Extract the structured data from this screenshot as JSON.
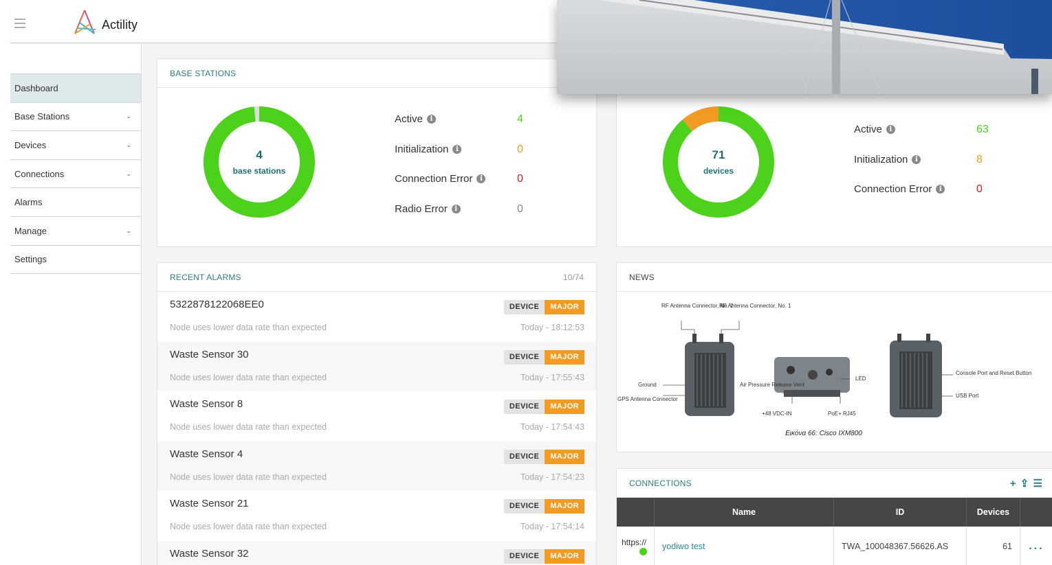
{
  "header": {
    "brand": "Actility"
  },
  "sidebar": {
    "items": [
      {
        "label": "Dashboard",
        "chevron": false,
        "active": true
      },
      {
        "label": "Base Stations",
        "chevron": true
      },
      {
        "label": "Devices",
        "chevron": true
      },
      {
        "label": "Connections",
        "chevron": true
      },
      {
        "label": "Alarms",
        "chevron": false
      },
      {
        "label": "Manage",
        "chevron": true
      },
      {
        "label": "Settings",
        "chevron": false
      }
    ]
  },
  "base_stations": {
    "title": "BASE STATIONS",
    "total": "4",
    "total_label": "base stations",
    "active_fraction": 0.985,
    "stats": [
      {
        "label": "Active",
        "value": "4",
        "color": "#4cd21a"
      },
      {
        "label": "Initialization",
        "value": "0",
        "color": "#f29b22"
      },
      {
        "label": "Connection Error",
        "value": "0",
        "color": "#e8141c"
      },
      {
        "label": "Radio Error",
        "value": "0",
        "color": "#888888"
      }
    ]
  },
  "devices": {
    "total": "71",
    "total_label": "devices",
    "stats": [
      {
        "label": "Active",
        "value": "63",
        "color": "#4cd21a"
      },
      {
        "label": "Initialization",
        "value": "8",
        "color": "#f29b22"
      },
      {
        "label": "Connection Error",
        "value": "0",
        "color": "#e8141c"
      }
    ]
  },
  "alarms": {
    "title": "RECENT ALARMS",
    "count": "10/74",
    "items": [
      {
        "name": "5322878122068EE0",
        "desc": "Node uses lower data rate than expected",
        "time": "Today - 18:12:53",
        "type": "DEVICE",
        "severity": "MAJOR"
      },
      {
        "name": "Waste Sensor 30",
        "desc": "Node uses lower data rate than expected",
        "time": "Today - 17:55:43",
        "type": "DEVICE",
        "severity": "MAJOR"
      },
      {
        "name": "Waste Sensor 8",
        "desc": "Node uses lower data rate than expected",
        "time": "Today - 17:54:43",
        "type": "DEVICE",
        "severity": "MAJOR"
      },
      {
        "name": "Waste Sensor 4",
        "desc": "Node uses lower data rate than expected",
        "time": "Today - 17:54:23",
        "type": "DEVICE",
        "severity": "MAJOR"
      },
      {
        "name": "Waste Sensor 21",
        "desc": "Node uses lower data rate than expected",
        "time": "Today - 17:54:14",
        "type": "DEVICE",
        "severity": "MAJOR"
      },
      {
        "name": "Waste Sensor 32",
        "desc": "",
        "time": "",
        "type": "DEVICE",
        "severity": "MAJOR"
      }
    ]
  },
  "news": {
    "title": "NEWS",
    "image": {
      "labels": {
        "rf2": "RF Antenna Connector, No. 2",
        "rf1": "RF Antenna Connector, No. 1",
        "ground": "Ground",
        "gps": "GPS Antenna Connector",
        "air": "Air Pressure Release Vent",
        "led": "LED",
        "vdc": "+48 VDC-IN",
        "poe": "PoE+ RJ45",
        "console": "Console Port and Reset Button",
        "usb": "USB Port"
      },
      "caption": "Εικόνα 66: Cisco IXM800"
    }
  },
  "connections": {
    "title": "CONNECTIONS",
    "tools": "+ ⇪ ☰",
    "columns": [
      "Name",
      "ID",
      "Devices"
    ],
    "rows": [
      {
        "protocol": "https://",
        "name": "yodiwo test",
        "id": "TWA_100048367.56626.AS",
        "devices": "61",
        "menu": "..."
      }
    ]
  }
}
